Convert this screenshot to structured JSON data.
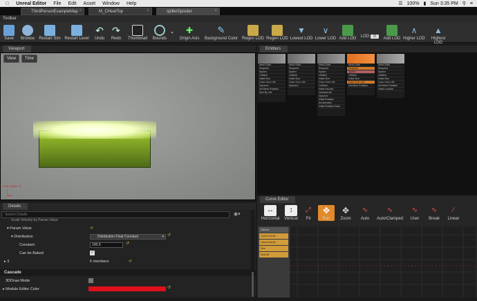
{
  "menubar": {
    "apple": "",
    "app": "Unreal Editor",
    "items": [
      "File",
      "Edit",
      "Asset",
      "Window",
      "Help"
    ],
    "battery": "100%",
    "time": "Sun 3:35 PM"
  },
  "tabs": [
    {
      "label": "ThirdPersonExampleMap"
    },
    {
      "label": "M_CHeatTop"
    },
    {
      "label": "spillerSpouter"
    }
  ],
  "toolbar_title": "Toolbar",
  "toolbar": [
    {
      "label": "Save"
    },
    {
      "label": "Browse"
    },
    {
      "label": "Restart Sim"
    },
    {
      "label": "Restart Level"
    },
    {
      "label": "Undo"
    },
    {
      "label": "Redo"
    },
    {
      "label": "Thumbnail"
    },
    {
      "label": "Bounds"
    },
    {
      "label": "Origin Axis"
    },
    {
      "label": "Background Color"
    },
    {
      "label": "Regen LOD"
    },
    {
      "label": "Regen LOD"
    },
    {
      "label": "Lowest LOD"
    },
    {
      "label": "Lower LOD"
    },
    {
      "label": "Add LOD"
    },
    {
      "label": "LOD"
    },
    {
      "label": "Add LOD"
    },
    {
      "label": "Higher LOD"
    },
    {
      "label": "Highest LOD"
    }
  ],
  "lod_value": "0",
  "viewport": {
    "title": "Viewport",
    "view_btn": "View",
    "time_btn": "Time",
    "stats": "Emits / Active: 12"
  },
  "emitters": {
    "title": "Emitters",
    "columns": [
      {
        "name": "",
        "rows": [
          "Mesh Data",
          "Required",
          "Spawn",
          "Lifetime",
          "Initial Size",
          "Color Over Life",
          "Dynamic",
          "Init Mesh Rotation",
          "Size By Life"
        ]
      },
      {
        "name": "",
        "rows": [
          "Mesh Data",
          "Required",
          "Spawn",
          "Lifetime",
          "Initial Size",
          "Color Over Life",
          "Dynamic"
        ]
      },
      {
        "name": "",
        "rows": [
          "Mesh Data",
          "Required",
          "Spawn",
          "Lifetime",
          "Initial Size",
          "Color Over Life",
          "Collision",
          "Initial Velocity",
          "Velocity/Life",
          "Dynamic",
          "Initial Rotation",
          "Acceleration",
          "Initial Rotation Rate"
        ]
      },
      {
        "name": "",
        "rows": [
          "Mesh Data",
          "Required",
          "Spawn",
          "Lifetime",
          "Initial Size",
          "Color Over Life",
          "Init Mesh Rotation"
        ]
      },
      {
        "name": "",
        "rows": [
          "Mesh Data",
          "Required",
          "Spawn",
          "Lifetime",
          "Initial Size",
          "Color Over Life",
          "Init Mesh Rotation",
          "Initial Location"
        ]
      }
    ]
  },
  "details": {
    "title": "Details",
    "search_placeholder": "Search Details",
    "rows": [
      {
        "label": "Scale Velocity by Param Value",
        "value": ""
      },
      {
        "label": "Param Value",
        "value": ""
      },
      {
        "label": "Distribution",
        "value": "Distribution Float Constant"
      },
      {
        "label": "Constant",
        "value": "100.0"
      },
      {
        "label": "Can be Baked",
        "value": ""
      },
      {
        "label": "3",
        "value": "6 members"
      }
    ],
    "cascade_title": "Cascade",
    "cascade_rows": [
      {
        "label": "3DDraw Mode",
        "value": ""
      },
      {
        "label": "Module Editor Color",
        "value": ""
      }
    ],
    "color": "#e0101a"
  },
  "curve": {
    "title": "Curve Editor",
    "buttons": [
      {
        "label": "Horizontal"
      },
      {
        "label": "Vertical"
      },
      {
        "label": "Fit"
      },
      {
        "label": "Pan"
      },
      {
        "label": "Zoom"
      },
      {
        "label": "Auto"
      },
      {
        "label": "Auto/Clamped"
      },
      {
        "label": "User"
      },
      {
        "label": "Break"
      },
      {
        "label": "Linear"
      }
    ],
    "curves": [
      "LifeLine",
      "ColorOverLife",
      "ColorOverLife",
      "Size",
      "SizeLife"
    ]
  }
}
